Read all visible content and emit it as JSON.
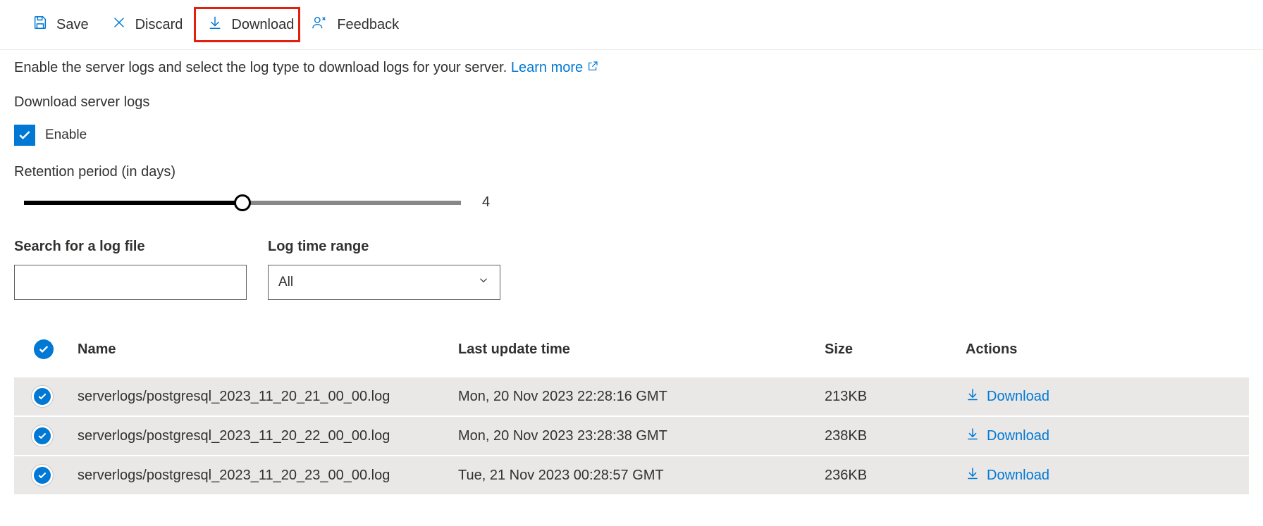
{
  "toolbar": {
    "save_label": "Save",
    "discard_label": "Discard",
    "download_label": "Download",
    "feedback_label": "Feedback"
  },
  "intro": {
    "text": "Enable the server logs and select the log type to download logs for your server.",
    "learn_more_label": "Learn more"
  },
  "download_section": {
    "heading": "Download server logs",
    "enable_label": "Enable",
    "enable_checked": true
  },
  "retention": {
    "label": "Retention period (in days)",
    "value": "4",
    "percent": 50
  },
  "filters": {
    "search_label": "Search for a log file",
    "search_value": "",
    "time_range_label": "Log time range",
    "time_range_value": "All"
  },
  "table": {
    "headers": {
      "name": "Name",
      "last_update": "Last update time",
      "size": "Size",
      "actions": "Actions"
    },
    "download_action_label": "Download",
    "rows": [
      {
        "name": "serverlogs/postgresql_2023_11_20_21_00_00.log",
        "time": "Mon, 20 Nov 2023 22:28:16 GMT",
        "size": "213KB"
      },
      {
        "name": "serverlogs/postgresql_2023_11_20_22_00_00.log",
        "time": "Mon, 20 Nov 2023 23:28:38 GMT",
        "size": "238KB"
      },
      {
        "name": "serverlogs/postgresql_2023_11_20_23_00_00.log",
        "time": "Tue, 21 Nov 2023 00:28:57 GMT",
        "size": "236KB"
      }
    ]
  }
}
